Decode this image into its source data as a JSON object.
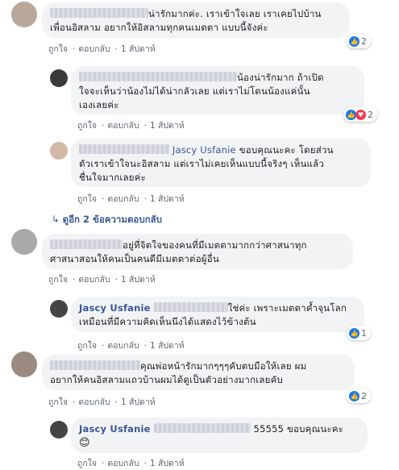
{
  "comments": [
    {
      "text": "น่ารักมากค่ะ. เราเข้าใจเลย เราเคยไปบ้าน",
      "text2": "เพื่อนอิสลาม อยากให้อิสลามทุกคนเมตตา แบบนี้จังค่ะ",
      "reactions": "2",
      "like": "ถูกใจ",
      "reply": "ตอบกลับ",
      "time": "1 สัปดาห์"
    },
    {
      "text": "น้องน่ารักมาก ถ้าเปิด",
      "text2": "ใจจะเห็นว่าน้องไม่ได้น่ากลัวเลย แต่เราไม่โดนน้องแค่นั้น",
      "text3": "เองเลยค่ะ",
      "reactions": "2",
      "like": "ถูกใจ",
      "reply": "ตอบกลับ",
      "time": "1 สัปดาห์"
    },
    {
      "name": "Jascy Usfanie",
      "text": "ขอบคุณนะคะ โดยส่วน",
      "text2": "ตัวเราเข้าใจนะอิสลาม แต่เราไม่เคยเห็นแบบนี้จริงๆ เห็นแล้ว",
      "text3": "ชื่นใจมากเลยค่ะ",
      "like": "ถูกใจ",
      "reply": "ตอบกลับ",
      "time": "1 สัปดาห์"
    },
    {
      "more": "ดูอีก 2 ข้อความตอบกลับ"
    },
    {
      "text": "อยู่ที่จิตใจของคนที่มีเมตตามากกว่าศาสนาทุก",
      "text2": "ศาสนาสอนให้คนเป็นคนดีมีเมตตาต่อผู้อื่น",
      "like": "ถูกใจ",
      "reply": "ตอบกลับ",
      "time": "1 สัปดาห์"
    },
    {
      "name": "Jascy Usfanie",
      "text": "ใช่ค่ะ เพราะเมตตาค้ำจุนโลก",
      "text2": "เหมือนที่มีความคิดเห็นนึงได้แสดงไว้ข้างต้น",
      "reactions": "1",
      "like": "ถูกใจ",
      "reply": "ตอบกลับ",
      "time": "1 สัปดาห์"
    },
    {
      "text": "คุณพ่อหน้ารักมากๆๆๆคับตบมือให้เลย ผม",
      "text2": "อยากให้คนอิสลามแถวบ้านผมได้ดูเป็นตัวอย่างมากเลยคับ",
      "reactions": "2",
      "like": "ถูกใจ",
      "reply": "ตอบกลับ",
      "time": "1 สัปดาห์"
    },
    {
      "name": "Jascy Usfanie",
      "text": "55555 ขอบคุณนะคะ",
      "emoji": "😊",
      "like": "ถูกใจ",
      "reply": "ตอบกลับ",
      "time": "1 สัปดาห์"
    }
  ],
  "colors": {
    "link": "#385898",
    "bubble": "#f2f3f5",
    "like": "#1877f2",
    "love": "#f33e58"
  },
  "icons": {
    "like": "thumbs-up-icon",
    "love": "heart-icon",
    "reply_arrow": "reply-arrow-icon"
  }
}
